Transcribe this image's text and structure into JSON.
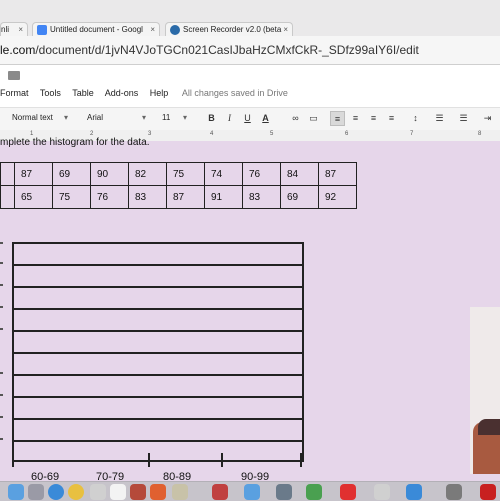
{
  "browser": {
    "tabs": [
      {
        "label": "nli",
        "close": "×"
      },
      {
        "label": "Untitled document - Googl",
        "close": "×"
      },
      {
        "label": "Screen Recorder v2.0 (beta",
        "close": "×"
      }
    ],
    "url_prefix": "le.com",
    "url_path": "/document/d/1jvN4VJoTGCn021CasIJbaHzCMxfCkR-_SDfz99aIY6I/edit"
  },
  "docs": {
    "menu": [
      "Format",
      "Tools",
      "Table",
      "Add-ons",
      "Help"
    ],
    "save_status": "All changes saved in Drive",
    "toolbar": {
      "style": "Normal text",
      "font": "Arial",
      "size": "11",
      "bold": "B",
      "italic": "I",
      "underline": "U",
      "text_color": "A"
    },
    "ruler_numbers": [
      "1",
      "2",
      "3",
      "4",
      "5",
      "6",
      "7",
      "8"
    ]
  },
  "document": {
    "instruction": "mplete the histogram for the data.",
    "data_rows": [
      [
        "87",
        "69",
        "90",
        "82",
        "75",
        "74",
        "76",
        "84",
        "87"
      ],
      [
        "65",
        "75",
        "76",
        "83",
        "87",
        "91",
        "83",
        "69",
        "92"
      ]
    ],
    "histogram_bins": [
      "60-69",
      "70-79",
      "80-89",
      "90-99"
    ]
  },
  "colors": {
    "page_background": "#e6d6ea",
    "docs_blue": "#4285f4"
  },
  "dock_icons": [
    "finder-icon",
    "launchpad-icon",
    "safari-icon",
    "chrome-icon",
    "photos-icon",
    "calendar-icon",
    "notes-icon",
    "reminders-icon",
    "maps-icon",
    "messages-icon",
    "facetime-icon",
    "music-icon",
    "books-icon",
    "appstore-icon",
    "preferences-icon",
    "acrobat-icon"
  ]
}
